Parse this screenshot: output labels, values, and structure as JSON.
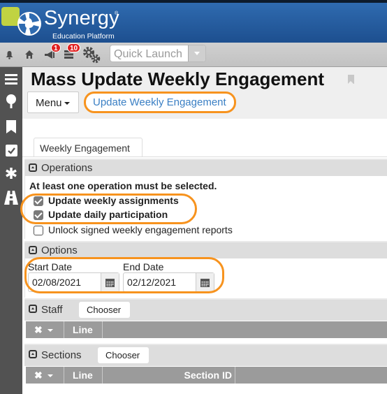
{
  "header": {
    "brand_name": "Synergy",
    "brand_reg": "®",
    "brand_sub": "Education Platform"
  },
  "navbar": {
    "icons": [
      "bell-icon",
      "home-icon",
      "megaphone-icon",
      "queue-icon",
      "gear-icon"
    ],
    "announcement_badge": "1",
    "queue_badge": "10",
    "quick_launch_placeholder": "Quick Launch"
  },
  "sidebar": {
    "icons": [
      "hamburger-icon",
      "tree-icon",
      "bookmark-icon",
      "checkbox-icon",
      "asterisk-icon",
      "road-icon"
    ]
  },
  "page": {
    "title": "Mass Update Weekly Engagement",
    "menu_label": "Menu",
    "update_button": "Update Weekly Engagement",
    "tab": "Weekly Engagement"
  },
  "operations": {
    "title": "Operations",
    "note": "At least one operation must be selected.",
    "items": [
      {
        "label": "Update weekly assignments",
        "checked": true
      },
      {
        "label": "Update daily participation",
        "checked": true
      },
      {
        "label": "Unlock signed weekly engagement reports",
        "checked": false
      }
    ]
  },
  "options": {
    "title": "Options",
    "start_label": "Start Date",
    "start_value": "02/08/2021",
    "end_label": "End Date",
    "end_value": "02/12/2021"
  },
  "staff": {
    "title": "Staff",
    "chooser": "Chooser",
    "columns": [
      "Line"
    ]
  },
  "sections": {
    "title": "Sections",
    "chooser": "Chooser",
    "columns": [
      "Line",
      "Section ID"
    ]
  },
  "colors": {
    "highlight": "#f7931e",
    "brand_blue": "#2f6bb0",
    "link_blue": "#3a7fc4",
    "badge_red": "#e02020"
  }
}
